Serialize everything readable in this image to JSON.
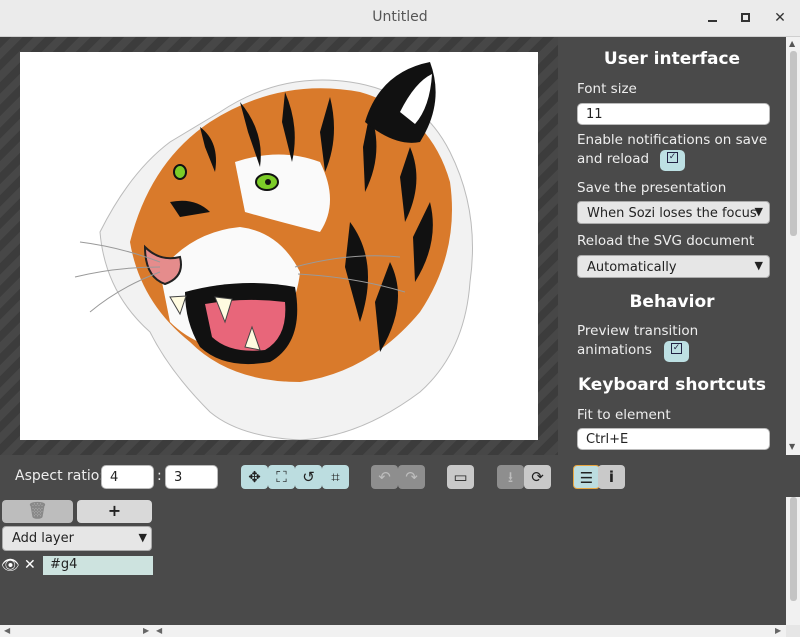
{
  "window": {
    "title": "Untitled"
  },
  "panel": {
    "sections": {
      "user_interface": "User interface",
      "behavior": "Behavior",
      "keyboard_shortcuts": "Keyboard shortcuts"
    },
    "font_size_label": "Font size",
    "font_size_value": "11",
    "notify_label_1": "Enable notifications on save",
    "notify_label_2": "and reload",
    "notify_checked": true,
    "save_label": "Save the presentation",
    "save_value": "When Sozi loses the focus",
    "reload_label": "Reload the SVG document",
    "reload_value": "Automatically",
    "preview_label_1": "Preview transition",
    "preview_label_2": "animations",
    "preview_checked": true,
    "fit_label": "Fit to element",
    "fit_value": "Ctrl+E"
  },
  "toolbar": {
    "aspect_label": "Aspect ratio:",
    "aspect_w": "4",
    "aspect_sep": ":",
    "aspect_h": "3"
  },
  "layers": {
    "add_layer_label": "Add layer",
    "items": [
      {
        "name": "#g4"
      }
    ]
  },
  "icons": {
    "move": "move-icon",
    "fit": "fit-icon",
    "rotate": "rotate-icon",
    "crop": "crop-icon",
    "undo": "undo-icon",
    "redo": "redo-icon",
    "presentation": "presentation-icon",
    "download": "download-icon",
    "reload": "reload-icon",
    "properties": "properties-icon",
    "info": "info-icon"
  },
  "colors": {
    "accent": "#bcdde0",
    "panel_bg": "#4a4a4a"
  }
}
